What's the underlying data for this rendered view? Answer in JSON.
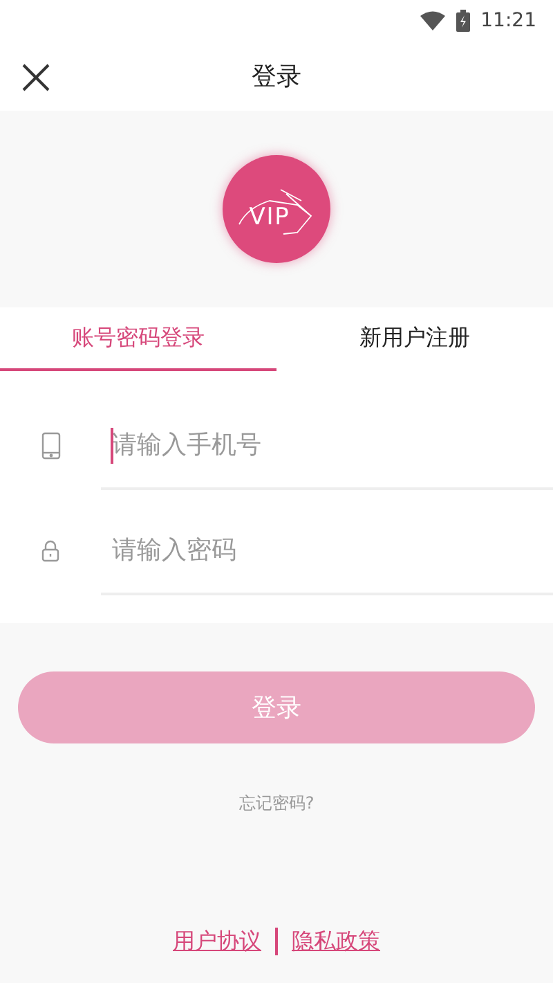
{
  "status_bar": {
    "time": "11:21"
  },
  "header": {
    "title": "登录"
  },
  "logo": {
    "text": "VIP"
  },
  "tabs": [
    {
      "label": "账号密码登录",
      "selected": true
    },
    {
      "label": "新用户注册",
      "selected": false
    }
  ],
  "fields": [
    {
      "kind": "phone",
      "placeholder": "请输入手机号",
      "focused": true
    },
    {
      "kind": "password",
      "placeholder": "请输入密码",
      "focused": false
    }
  ],
  "login_button": {
    "label": "登录",
    "disabled": true
  },
  "forgot_link": "忘记密码?",
  "footer_links": [
    "用户协议",
    "隐私政策"
  ]
}
